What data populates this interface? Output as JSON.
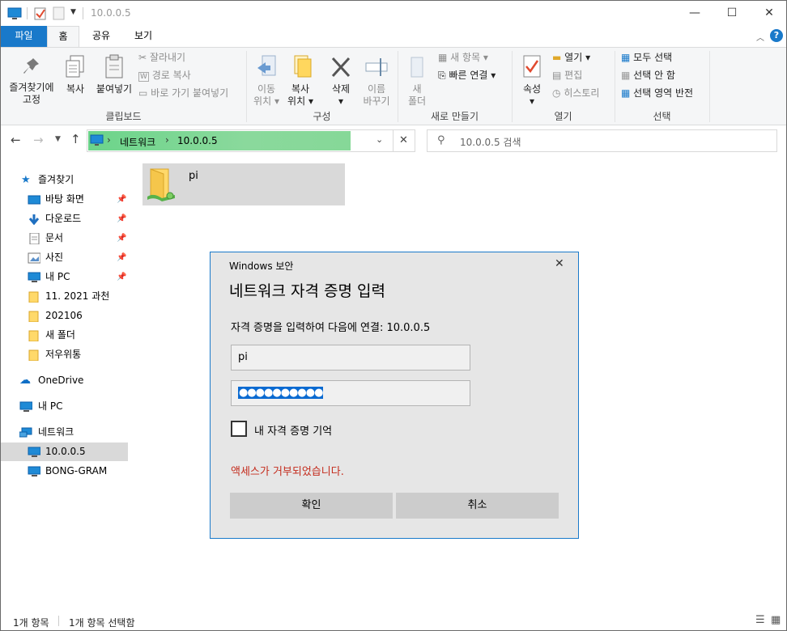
{
  "window": {
    "title": "10.0.0.5",
    "minimize": "—",
    "maximize": "☐",
    "close": "✕"
  },
  "tabs": [
    {
      "label": "파일"
    },
    {
      "label": "홈"
    },
    {
      "label": "공유"
    },
    {
      "label": "보기"
    }
  ],
  "ribbon": {
    "clipboard": {
      "pin_label_1": "즐겨찾기에",
      "pin_label_2": "고정",
      "copy": "복사",
      "paste": "붙여넣기",
      "cut": "잘라내기",
      "copy_path": "경로 복사",
      "paste_shortcut": "바로 가기 붙여넣기",
      "group": "클립보드"
    },
    "organize": {
      "move_1": "이동",
      "move_2": "위치",
      "copy_1": "복사",
      "copy_2": "위치",
      "delete": "삭제",
      "rename_1": "이름",
      "rename_2": "바꾸기",
      "group": "구성"
    },
    "new": {
      "new_folder_1": "새",
      "new_folder_2": "폴더",
      "new_item": "새 항목",
      "easy_access": "빠른 연결",
      "group": "새로 만들기"
    },
    "open": {
      "properties": "속성",
      "open": "열기",
      "edit": "편집",
      "history": "히스토리",
      "group": "열기"
    },
    "select": {
      "select_all": "모두 선택",
      "select_none": "선택 안 함",
      "invert": "선택 영역 반전",
      "group": "선택"
    }
  },
  "address": {
    "root": "네트워크",
    "sep": "›",
    "current": "10.0.0.5",
    "search_placeholder": "10.0.0.5 검색"
  },
  "nav": {
    "quick_access": "즐겨찾기",
    "items": [
      {
        "label": "바탕 화면",
        "pinned": true
      },
      {
        "label": "다운로드",
        "pinned": true
      },
      {
        "label": "문서",
        "pinned": true
      },
      {
        "label": "사진",
        "pinned": true
      },
      {
        "label": "내 PC",
        "pinned": true
      },
      {
        "label": "11. 2021 과천",
        "pinned": false
      },
      {
        "label": "202106",
        "pinned": false
      },
      {
        "label": "새 폴더",
        "pinned": false
      },
      {
        "label": "저우위통",
        "pinned": false
      }
    ],
    "onedrive": "OneDrive",
    "this_pc": "내 PC",
    "network": "네트워크",
    "net_items": [
      {
        "label": "10.0.0.5"
      },
      {
        "label": "BONG-GRAM"
      }
    ]
  },
  "content": {
    "folder_name": "pi"
  },
  "status": {
    "count": "1개 항목",
    "selected": "1개 항목 선택함"
  },
  "dialog": {
    "caption": "Windows 보안",
    "heading": "네트워크 자격 증명 입력",
    "message": "자격 증명을 입력하여 다음에 연결: 10.0.0.5",
    "username": "pi",
    "password_mask": "●●●●●●●●●●",
    "remember": "내 자격 증명 기억",
    "error": "액세스가 거부되었습니다.",
    "ok": "확인",
    "cancel": "취소",
    "close": "✕",
    "error_color": "#c42b1c"
  },
  "colors": {
    "accent": "#1979ca",
    "selection": "#d9d9d9",
    "address_fill": "#7ed693"
  }
}
